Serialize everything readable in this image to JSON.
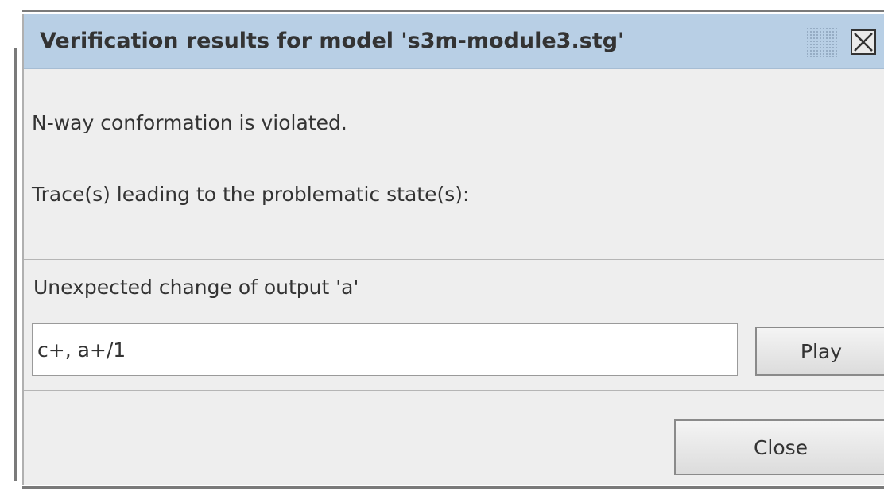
{
  "dialog": {
    "title": "Verification results for model 's3m-module3.stg'",
    "close_icon": "close-x-icon",
    "message_line1": "N-way conformation is violated.",
    "message_line2": "Trace(s) leading to the problematic state(s):"
  },
  "trace": {
    "label": "Unexpected change of output 'a'",
    "value": "c+, a+/1",
    "play_label": "Play"
  },
  "footer": {
    "close_label": "Close"
  },
  "colors": {
    "titlebar": "#b8cfe5",
    "dialog_bg": "#eeeeee",
    "text": "#333333"
  }
}
